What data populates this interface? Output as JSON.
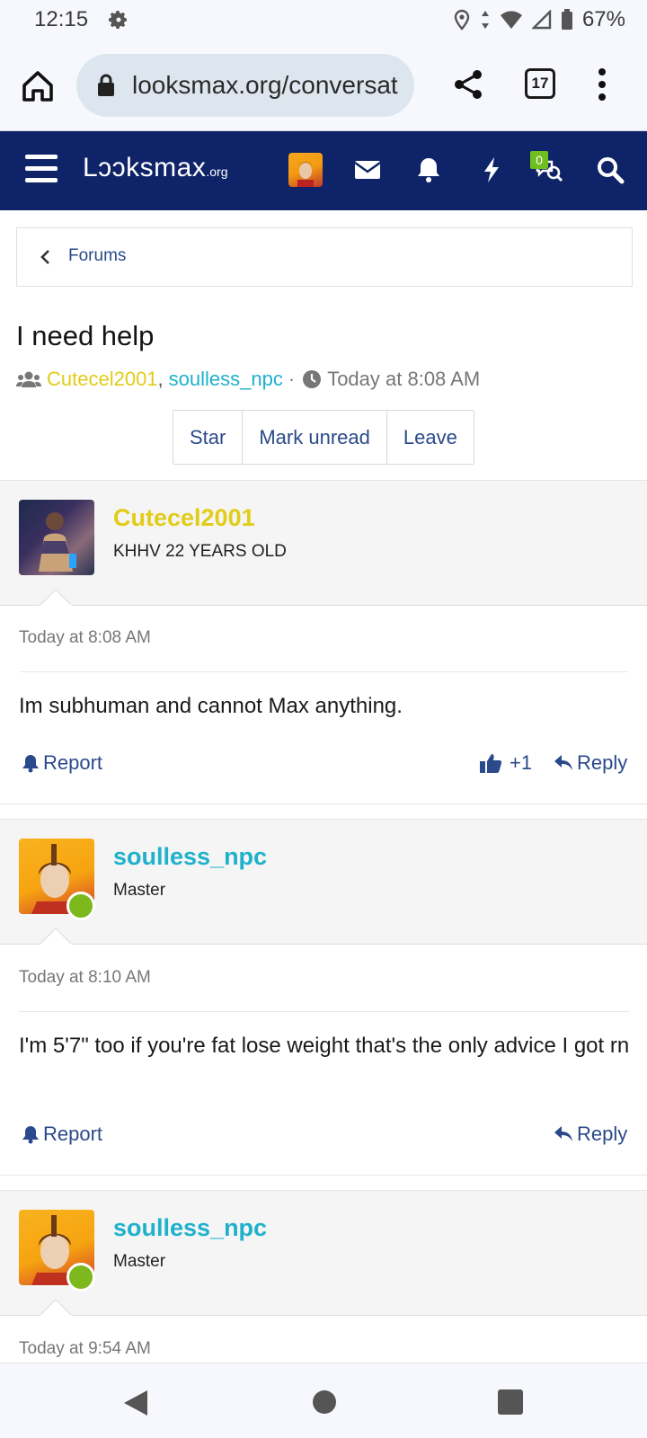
{
  "status_bar": {
    "time": "12:15",
    "battery": "67%"
  },
  "browser": {
    "url": "looksmax.org/conversat",
    "tab_count": "17"
  },
  "site": {
    "logo_main": "Lɔɔksmax",
    "logo_suffix": ".org",
    "badge_count": "0",
    "brand_color": "#0f2468"
  },
  "breadcrumb": {
    "label": "Forums"
  },
  "conversation": {
    "title": "I need help",
    "participants": [
      "Cutecel2001",
      "soulless_npc"
    ],
    "separator": ",",
    "dot": "·",
    "started": "Today at 8:08 AM",
    "buttons": [
      "Star",
      "Mark unread",
      "Leave"
    ]
  },
  "messages": [
    {
      "username": "Cutecel2001",
      "user_title": "KHHV 22 YEARS OLD",
      "time": "Today at 8:08 AM",
      "body": "Im subhuman and cannot Max anything.",
      "report_label": "Report",
      "reaction_count": "+1",
      "reply_label": "Reply"
    },
    {
      "username": "soulless_npc",
      "user_title": "Master",
      "time": "Today at 8:10 AM",
      "body": "I'm 5'7\" too if you're fat lose weight that's the only advice I got rn",
      "report_label": "Report",
      "reply_label": "Reply"
    },
    {
      "username": "soulless_npc",
      "user_title": "Master",
      "time": "Today at 9:54 AM"
    }
  ],
  "colors": {
    "link": "#2b4a8b",
    "user_yellow": "#e2cc18",
    "user_cyan": "#1fb1cc",
    "online": "#7db81c"
  }
}
